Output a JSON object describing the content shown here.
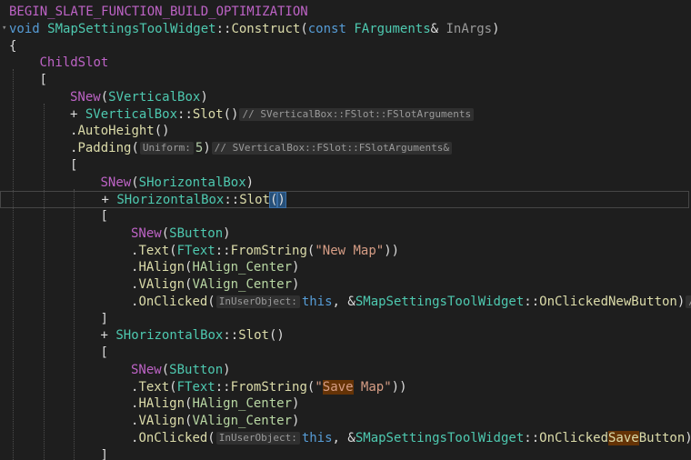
{
  "editor": {
    "lines": [
      {
        "indent": 0,
        "parts": [
          {
            "t": "BEGIN_SLATE_FUNCTION_BUILD_OPTIMIZATION",
            "c": "macro"
          }
        ]
      },
      {
        "indent": 0,
        "parts": [
          {
            "t": "void",
            "c": "kw"
          },
          {
            "t": " "
          },
          {
            "t": "SMapSettingsToolWidget",
            "c": "ty"
          },
          {
            "t": "::"
          },
          {
            "t": "Construct",
            "c": "fn"
          },
          {
            "t": "("
          },
          {
            "t": "const",
            "c": "kw"
          },
          {
            "t": " "
          },
          {
            "t": "FArguments",
            "c": "ty"
          },
          {
            "t": "& "
          },
          {
            "t": "InArgs",
            "c": "par"
          },
          {
            "t": ")"
          }
        ]
      },
      {
        "indent": 0,
        "parts": [
          {
            "t": "{"
          }
        ]
      },
      {
        "indent": 1,
        "parts": [
          {
            "t": "ChildSlot",
            "c": "macro"
          }
        ]
      },
      {
        "indent": 1,
        "parts": [
          {
            "t": "["
          }
        ]
      },
      {
        "indent": 2,
        "parts": [
          {
            "t": "SNew",
            "c": "macro"
          },
          {
            "t": "("
          },
          {
            "t": "SVerticalBox",
            "c": "ty"
          },
          {
            "t": ")"
          }
        ]
      },
      {
        "indent": 2,
        "parts": [
          {
            "t": "+ "
          },
          {
            "t": "SVerticalBox",
            "c": "ty"
          },
          {
            "t": "::"
          },
          {
            "t": "Slot",
            "c": "fn"
          },
          {
            "t": "()"
          },
          {
            "t": "// SVerticalBox::FSlot::FSlotArguments",
            "c": "hint"
          }
        ]
      },
      {
        "indent": 2,
        "parts": [
          {
            "t": "."
          },
          {
            "t": "AutoHeight",
            "c": "fn"
          },
          {
            "t": "()"
          }
        ]
      },
      {
        "indent": 2,
        "parts": [
          {
            "t": "."
          },
          {
            "t": "Padding",
            "c": "fn"
          },
          {
            "t": "("
          },
          {
            "t": "Uniform:",
            "c": "hint"
          },
          {
            "t": "5",
            "c": "num"
          },
          {
            "t": ")"
          },
          {
            "t": "// SVerticalBox::FSlot::FSlotArguments&",
            "c": "hint"
          }
        ]
      },
      {
        "indent": 2,
        "parts": [
          {
            "t": "["
          }
        ]
      },
      {
        "indent": 3,
        "parts": [
          {
            "t": "SNew",
            "c": "macro"
          },
          {
            "t": "("
          },
          {
            "t": "SHorizontalBox",
            "c": "ty"
          },
          {
            "t": ")"
          }
        ]
      },
      {
        "indent": 3,
        "current": true,
        "parts": [
          {
            "t": "+ "
          },
          {
            "t": "SHorizontalBox",
            "c": "ty"
          },
          {
            "t": "::"
          },
          {
            "t": "Slot",
            "c": "fn"
          },
          {
            "t": "(",
            "c": "match"
          },
          {
            "t": ")",
            "c": "match"
          }
        ]
      },
      {
        "indent": 3,
        "parts": [
          {
            "t": "["
          }
        ]
      },
      {
        "indent": 4,
        "parts": [
          {
            "t": "SNew",
            "c": "macro"
          },
          {
            "t": "("
          },
          {
            "t": "SButton",
            "c": "ty"
          },
          {
            "t": ")"
          }
        ]
      },
      {
        "indent": 4,
        "parts": [
          {
            "t": "."
          },
          {
            "t": "Text",
            "c": "fn"
          },
          {
            "t": "("
          },
          {
            "t": "FText",
            "c": "ty"
          },
          {
            "t": "::"
          },
          {
            "t": "FromString",
            "c": "fn"
          },
          {
            "t": "("
          },
          {
            "t": "\"New Map\"",
            "c": "str"
          },
          {
            "t": "))"
          }
        ]
      },
      {
        "indent": 4,
        "parts": [
          {
            "t": "."
          },
          {
            "t": "HAlign",
            "c": "fn"
          },
          {
            "t": "("
          },
          {
            "t": "HAlign_Center",
            "c": "en"
          },
          {
            "t": ")"
          }
        ]
      },
      {
        "indent": 4,
        "parts": [
          {
            "t": "."
          },
          {
            "t": "VAlign",
            "c": "fn"
          },
          {
            "t": "("
          },
          {
            "t": "VAlign_Center",
            "c": "en"
          },
          {
            "t": ")"
          }
        ]
      },
      {
        "indent": 4,
        "parts": [
          {
            "t": "."
          },
          {
            "t": "OnClicked",
            "c": "fn"
          },
          {
            "t": "("
          },
          {
            "t": "InUserObject:",
            "c": "hint"
          },
          {
            "t": "this",
            "c": "kw"
          },
          {
            "t": ", &"
          },
          {
            "t": "SMapSettingsToolWidget",
            "c": "ty"
          },
          {
            "t": "::"
          },
          {
            "t": "OnClickedNewButton",
            "c": "fn"
          },
          {
            "t": ")"
          },
          {
            "t": "//",
            "c": "hint"
          }
        ]
      },
      {
        "indent": 3,
        "parts": [
          {
            "t": "]"
          }
        ]
      },
      {
        "indent": 3,
        "parts": [
          {
            "t": "+ "
          },
          {
            "t": "SHorizontalBox",
            "c": "ty"
          },
          {
            "t": "::"
          },
          {
            "t": "Slot",
            "c": "fn"
          },
          {
            "t": "()"
          }
        ]
      },
      {
        "indent": 3,
        "parts": [
          {
            "t": "["
          }
        ]
      },
      {
        "indent": 4,
        "parts": [
          {
            "t": "SNew",
            "c": "macro"
          },
          {
            "t": "("
          },
          {
            "t": "SButton",
            "c": "ty"
          },
          {
            "t": ")"
          }
        ]
      },
      {
        "indent": 4,
        "parts": [
          {
            "t": "."
          },
          {
            "t": "Text",
            "c": "fn"
          },
          {
            "t": "("
          },
          {
            "t": "FText",
            "c": "ty"
          },
          {
            "t": "::"
          },
          {
            "t": "FromString",
            "c": "fn"
          },
          {
            "t": "("
          },
          {
            "t": "\"",
            "c": "str"
          },
          {
            "t": "Save",
            "c": "str hl"
          },
          {
            "t": " Map\"",
            "c": "str"
          },
          {
            "t": "))"
          }
        ]
      },
      {
        "indent": 4,
        "parts": [
          {
            "t": "."
          },
          {
            "t": "HAlign",
            "c": "fn"
          },
          {
            "t": "("
          },
          {
            "t": "HAlign_Center",
            "c": "en"
          },
          {
            "t": ")"
          }
        ]
      },
      {
        "indent": 4,
        "parts": [
          {
            "t": "."
          },
          {
            "t": "VAlign",
            "c": "fn"
          },
          {
            "t": "("
          },
          {
            "t": "VAlign_Center",
            "c": "en"
          },
          {
            "t": ")"
          }
        ]
      },
      {
        "indent": 4,
        "parts": [
          {
            "t": "."
          },
          {
            "t": "OnClicked",
            "c": "fn"
          },
          {
            "t": "("
          },
          {
            "t": "InUserObject:",
            "c": "hint"
          },
          {
            "t": "this",
            "c": "kw"
          },
          {
            "t": ", &"
          },
          {
            "t": "SMapSettingsToolWidget",
            "c": "ty"
          },
          {
            "t": "::"
          },
          {
            "t": "OnClicked",
            "c": "fn"
          },
          {
            "t": "Save",
            "c": "fn hl"
          },
          {
            "t": "Button",
            "c": "fn"
          },
          {
            "t": ")/"
          }
        ]
      },
      {
        "indent": 3,
        "parts": [
          {
            "t": "]"
          }
        ]
      }
    ]
  }
}
